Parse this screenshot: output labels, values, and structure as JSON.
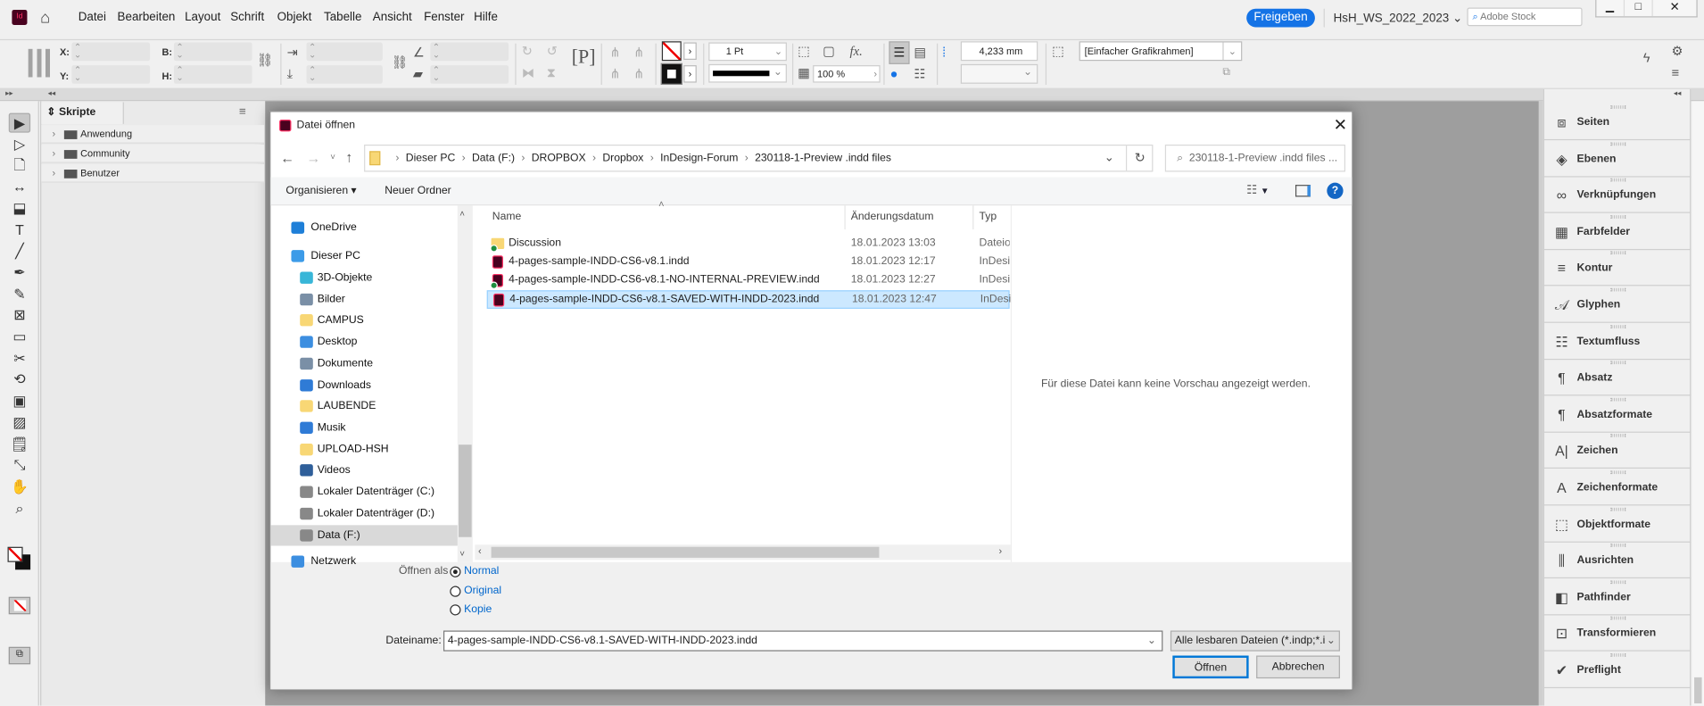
{
  "app": {
    "menu": [
      "Datei",
      "Bearbeiten",
      "Layout",
      "Schrift",
      "Objekt",
      "Tabelle",
      "Ansicht",
      "Fenster",
      "Hilfe"
    ],
    "share_label": "Freigeben",
    "workspace": "HsH_WS_2022_2023",
    "stock_placeholder": "Adobe Stock",
    "logo": "Id"
  },
  "control": {
    "x_label": "X:",
    "y_label": "Y:",
    "w_label": "B:",
    "h_label": "H:",
    "stroke_weight": "1 Pt",
    "opacity": "100 %",
    "gap": "4,233 mm",
    "object_style": "[Einfacher Grafikrahmen]",
    "fx": "fx."
  },
  "scripts_panel": {
    "tab": "Skripte",
    "items": [
      "Anwendung",
      "Community",
      "Benutzer"
    ]
  },
  "right_panel": {
    "items": [
      {
        "label": "Seiten",
        "icon": "pages-icon"
      },
      {
        "label": "Ebenen",
        "icon": "layers-icon"
      },
      {
        "label": "Verknüpfungen",
        "icon": "links-icon"
      },
      {
        "label": "Farbfelder",
        "icon": "swatches-icon"
      },
      {
        "label": "Kontur",
        "icon": "stroke-icon"
      },
      {
        "label": "Glyphen",
        "icon": "glyphs-icon"
      },
      {
        "label": "Textumfluss",
        "icon": "text-wrap-icon"
      },
      {
        "label": "Absatz",
        "icon": "paragraph-icon"
      },
      {
        "label": "Absatzformate",
        "icon": "paragraph-styles-icon"
      },
      {
        "label": "Zeichen",
        "icon": "character-icon"
      },
      {
        "label": "Zeichenformate",
        "icon": "character-styles-icon"
      },
      {
        "label": "Objektformate",
        "icon": "object-styles-icon"
      },
      {
        "label": "Ausrichten",
        "icon": "align-icon"
      },
      {
        "label": "Pathfinder",
        "icon": "pathfinder-icon"
      },
      {
        "label": "Transformieren",
        "icon": "transform-icon"
      },
      {
        "label": "Preflight",
        "icon": "preflight-icon"
      }
    ]
  },
  "dialog": {
    "title": "Datei öffnen",
    "breadcrumb": [
      "Dieser PC",
      "Data (F:)",
      "DROPBOX",
      "Dropbox",
      "InDesign-Forum",
      "230118-1-Preview .indd files"
    ],
    "search_placeholder": "230118-1-Preview .indd files ...",
    "toolbar": {
      "organize": "Organisieren ▾",
      "new_folder": "Neuer Ordner"
    },
    "nav": [
      {
        "label": "OneDrive",
        "level": 0
      },
      {
        "label": "Dieser PC",
        "level": 0
      },
      {
        "label": "3D-Objekte",
        "level": 1
      },
      {
        "label": "Bilder",
        "level": 1
      },
      {
        "label": "CAMPUS",
        "level": 1
      },
      {
        "label": "Desktop",
        "level": 1
      },
      {
        "label": "Dokumente",
        "level": 1
      },
      {
        "label": "Downloads",
        "level": 1
      },
      {
        "label": "LAUBENDE",
        "level": 1
      },
      {
        "label": "Musik",
        "level": 1
      },
      {
        "label": "UPLOAD-HSH",
        "level": 1
      },
      {
        "label": "Videos",
        "level": 1
      },
      {
        "label": "Lokaler Datenträger (C:)",
        "level": 1
      },
      {
        "label": "Lokaler Datenträger (D:)",
        "level": 1
      },
      {
        "label": "Data (F:)",
        "level": 1,
        "selected": true
      },
      {
        "label": "Netzwerk",
        "level": 0
      }
    ],
    "columns": [
      "Name",
      "Änderungsdatum",
      "Typ"
    ],
    "files": [
      {
        "name": "Discussion",
        "date": "18.01.2023 13:03",
        "type": "Dateiordner",
        "kind": "folder"
      },
      {
        "name": "4-pages-sample-INDD-CS6-v8.1.indd",
        "date": "18.01.2023 12:17",
        "type": "InDesign",
        "kind": "indd"
      },
      {
        "name": "4-pages-sample-INDD-CS6-v8.1-NO-INTERNAL-PREVIEW.indd",
        "date": "18.01.2023 12:27",
        "type": "InDesign",
        "kind": "indd"
      },
      {
        "name": "4-pages-sample-INDD-CS6-v8.1-SAVED-WITH-INDD-2023.indd",
        "date": "18.01.2023 12:47",
        "type": "InDesign",
        "kind": "indd",
        "selected": true
      }
    ],
    "preview_text": "Für diese Datei kann keine Vorschau angezeigt werden.",
    "open_as_label": "Öffnen als",
    "open_as_options": [
      "Normal",
      "Original",
      "Kopie"
    ],
    "open_as_selected": "Normal",
    "filename_label": "Dateiname:",
    "filename_value": "4-pages-sample-INDD-CS6-v8.1-SAVED-WITH-INDD-2023.indd",
    "filter": "Alle lesbaren Dateien (*.indp;*.i",
    "open_button": "Öffnen",
    "cancel_button": "Abbrechen"
  }
}
